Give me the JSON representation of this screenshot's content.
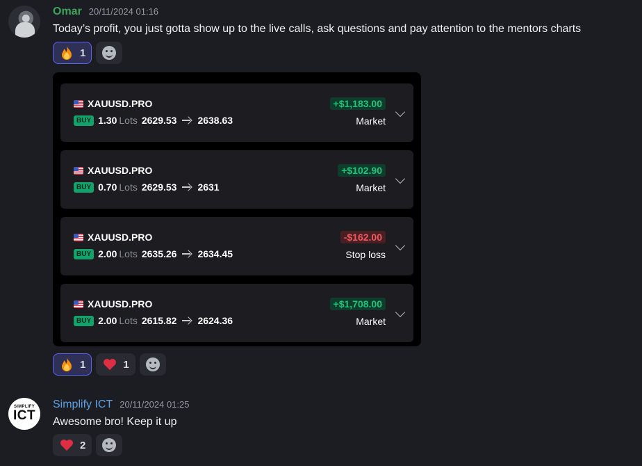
{
  "messages": [
    {
      "author": "Omar",
      "timestamp": "20/11/2024 01:16",
      "text": "Today’s profit, you just gotta show up to the live calls, ask questions and pay attention to the mentors charts",
      "reactions": [
        {
          "emoji": "fire-icon",
          "count": "1",
          "active": true
        }
      ],
      "trades": [
        {
          "symbol": "XAUUSD.PRO",
          "side": "BUY",
          "lots": "1.30",
          "lots_label": "Lots",
          "open": "2629.53",
          "close": "2638.63",
          "pnl": "+$1,183.00",
          "pnl_sign": "positive",
          "close_type": "Market"
        },
        {
          "symbol": "XAUUSD.PRO",
          "side": "BUY",
          "lots": "0.70",
          "lots_label": "Lots",
          "open": "2629.53",
          "close": "2631",
          "pnl": "+$102.90",
          "pnl_sign": "positive",
          "close_type": "Market"
        },
        {
          "symbol": "XAUUSD.PRO",
          "side": "BUY",
          "lots": "2.00",
          "lots_label": "Lots",
          "open": "2635.26",
          "close": "2634.45",
          "pnl": "-$162.00",
          "pnl_sign": "negative",
          "close_type": "Stop loss"
        },
        {
          "symbol": "XAUUSD.PRO",
          "side": "BUY",
          "lots": "2.00",
          "lots_label": "Lots",
          "open": "2615.82",
          "close": "2624.36",
          "pnl": "+$1,708.00",
          "pnl_sign": "positive",
          "close_type": "Market"
        }
      ],
      "embed_reactions": [
        {
          "emoji": "fire-icon",
          "count": "1",
          "active": true
        },
        {
          "emoji": "heart-icon",
          "count": "1",
          "active": false
        }
      ]
    },
    {
      "author": "Simplify ICT",
      "avatar_small": "SIMPLIFY",
      "avatar_big": "ICT",
      "timestamp": "20/11/2024 01:25",
      "text": "Awesome bro! Keep it up",
      "reactions": [
        {
          "emoji": "heart-icon",
          "count": "2",
          "active": false
        }
      ]
    }
  ],
  "colors": {
    "background": "#1c1c23",
    "omar_name": "#3ba55c",
    "simplify_name": "#5ba1e6",
    "profit": "#23c27c",
    "loss": "#ef5a5f",
    "buy_badge": "#11a36b",
    "active_reaction_border": "#5865f2"
  }
}
